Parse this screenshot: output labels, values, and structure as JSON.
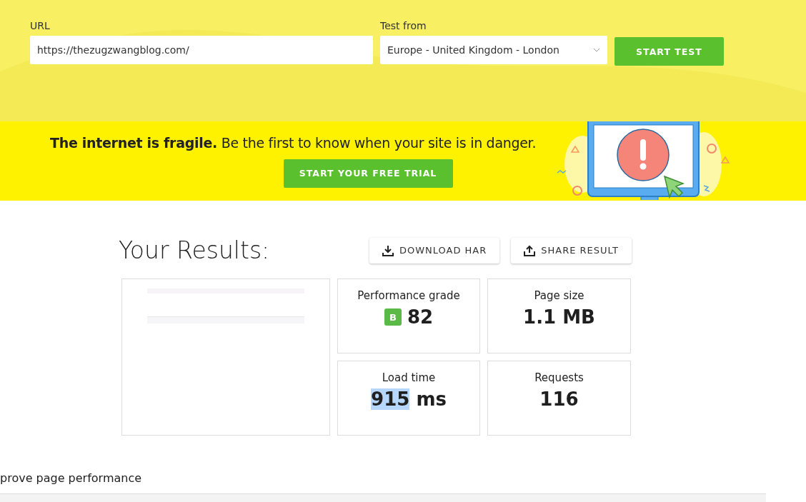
{
  "test_form": {
    "url_label": "URL",
    "url_value": "https://thezugzwangblog.com/",
    "location_label": "Test from",
    "location_value": "Europe - United Kingdom - London",
    "start_button": "START TEST"
  },
  "banner": {
    "headline_bold": "The internet is fragile.",
    "headline_rest": "Be the first to know when your site is in danger.",
    "trial_button": "START YOUR FREE TRIAL"
  },
  "results": {
    "title": "Your Results:",
    "actions": [
      {
        "label": "DOWNLOAD HAR",
        "kind": "download"
      },
      {
        "label": "SHARE RESULT",
        "kind": "share"
      }
    ],
    "stats": [
      {
        "label": "Performance grade",
        "grade": "B",
        "value": "82",
        "selected": false
      },
      {
        "label": "Page size",
        "value": "1.1 MB",
        "selected": false
      },
      {
        "label": "Load time",
        "value": "915",
        "unit": "ms",
        "selected": true
      },
      {
        "label": "Requests",
        "value": "116",
        "selected": false
      }
    ]
  },
  "suggestions": {
    "title": "prove page performance"
  }
}
